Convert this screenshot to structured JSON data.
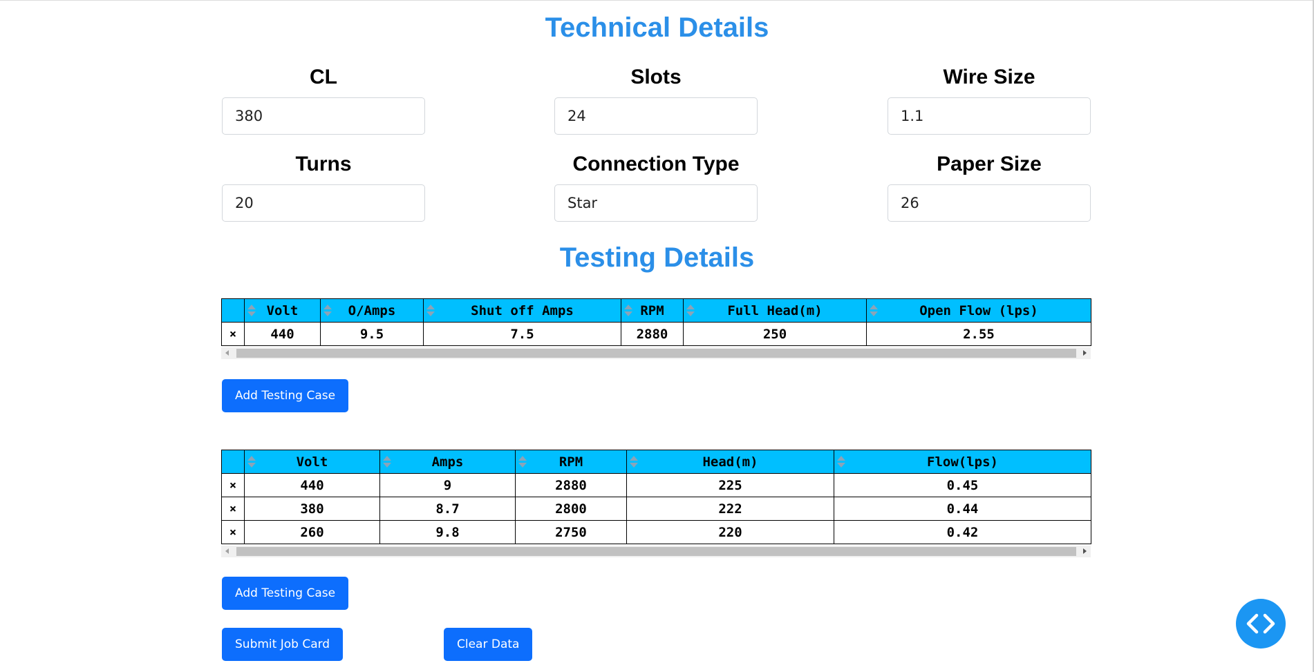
{
  "technical": {
    "title": "Technical Details",
    "fields": [
      {
        "label": "CL",
        "value": "380"
      },
      {
        "label": "Slots",
        "value": "24"
      },
      {
        "label": "Wire Size",
        "value": "1.1"
      },
      {
        "label": "Turns",
        "value": "20"
      },
      {
        "label": "Connection Type",
        "value": "Star"
      },
      {
        "label": "Paper Size",
        "value": "26"
      }
    ]
  },
  "testing": {
    "title": "Testing Details",
    "table1": {
      "remove_symbol": "×",
      "headers": [
        "Volt",
        "O/Amps",
        "Shut off Amps",
        "RPM",
        "Full Head(m)",
        "Open Flow (lps)"
      ],
      "rows": [
        [
          "440",
          "9.5",
          "7.5",
          "2880",
          "250",
          "2.55"
        ]
      ]
    },
    "table2": {
      "remove_symbol": "×",
      "headers": [
        "Volt",
        "Amps",
        "RPM",
        "Head(m)",
        "Flow(lps)"
      ],
      "rows": [
        [
          "440",
          "9",
          "2880",
          "225",
          "0.45"
        ],
        [
          "380",
          "8.7",
          "2800",
          "222",
          "0.44"
        ],
        [
          "260",
          "9.8",
          "2750",
          "220",
          "0.42"
        ]
      ]
    },
    "add_case_label": "Add Testing Case"
  },
  "actions": {
    "submit_label": "Submit Job Card",
    "clear_label": "Clear Data"
  },
  "colors": {
    "title": "#2b8fe8",
    "table_header": "#00bfff",
    "button": "#0d6efd",
    "fab": "#1b96f3"
  },
  "icons": {
    "sort": "sort-updown-icon",
    "fab": "code-brackets-icon"
  }
}
